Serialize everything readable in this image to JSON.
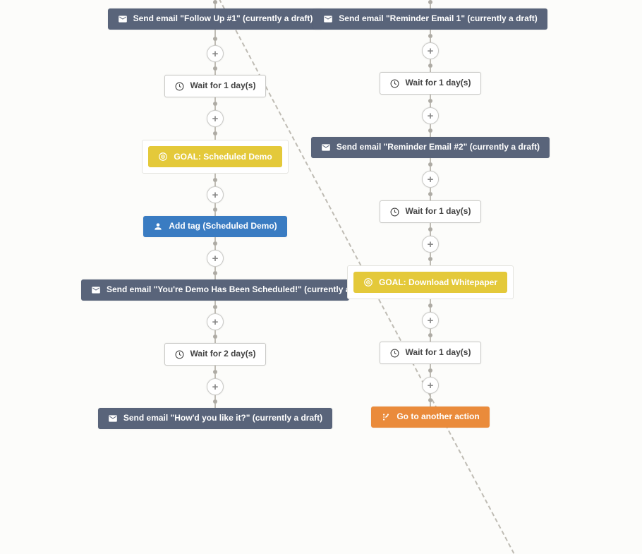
{
  "left": {
    "n0": "Send email \"Follow Up #1\" (currently a draft)",
    "n1": "Wait for 1 day(s)",
    "n2": "GOAL: Scheduled Demo",
    "n3": "Add tag (Scheduled Demo)",
    "n4": "Send email \"You're Demo Has Been Scheduled!\" (currently a draft)",
    "n5": "Wait for 2 day(s)",
    "n6": "Send email \"How'd you like it?\" (currently a draft)"
  },
  "right": {
    "n0": "Send email \"Reminder Email 1\" (currently a draft)",
    "n1": "Wait for 1 day(s)",
    "n2": "Send email \"Reminder Email #2\" (currently a draft)",
    "n3": "Wait for 1 day(s)",
    "n4": "GOAL: Download Whitepaper",
    "n5": "Wait for 1 day(s)",
    "n6": "Go to another action"
  }
}
